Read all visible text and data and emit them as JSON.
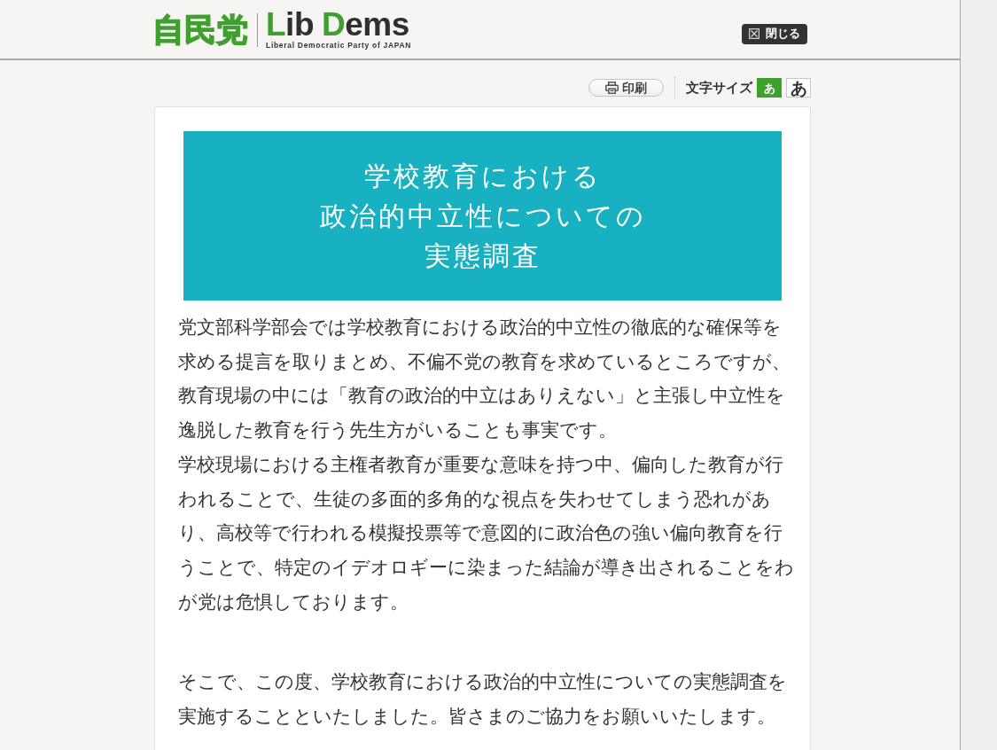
{
  "header": {
    "logo": {
      "mark": "自民党",
      "wordmark": [
        [
          {
            "text": "L",
            "accent": true
          },
          {
            "text": "ib",
            "accent": false
          }
        ],
        [
          {
            "text": "D",
            "accent": true
          },
          {
            "text": "ems",
            "accent": false
          }
        ]
      ],
      "tagline": "Liberal Democratic Party of JAPAN"
    },
    "close_button": {
      "label": "閉じる"
    }
  },
  "toolbar": {
    "print_button": {
      "label": "印刷"
    },
    "text_size": {
      "label": "文字サイズ",
      "options": [
        {
          "label": "あ",
          "kind": "small",
          "selected": true
        },
        {
          "label": "あ",
          "kind": "large",
          "selected": false
        }
      ]
    }
  },
  "article": {
    "banner": {
      "title_lines": [
        "学校教育における",
        "政治的中立性についての",
        "実態調査"
      ]
    },
    "blocks": [
      {
        "paragraphs": [
          {
            "lines": [
              "党文部科学部会では学校教育における政治的中立性の徹底的な確保等を",
              "求める提言を取りまとめ、不偏不党の教育を求めているところですが、",
              "教育現場の中には「教育の政治的中立はありえない」と主張し中立性を",
              "逸脱した教育を行う先生方がいることも事実です。"
            ]
          },
          {
            "lines": [
              "学校現場における主権者教育が重要な意味を持つ中、偏向した教育が行",
              "われることで、生徒の多面的多角的な視点を失わせてしまう恐れがあ",
              "り、高校等で行われる模擬投票等で意図的に政治色の強い偏向教育を行",
              "うことで、特定のイデオロギーに染まった結論が導き出されることをわ",
              "が党は危惧しております。"
            ]
          }
        ]
      },
      {
        "paragraphs": [
          {
            "lines": [
              "そこで、この度、学校教育における政治的中立性についての実態調査を",
              "実施することといたしました。皆さまのご協力をお願いいたします。"
            ]
          }
        ]
      }
    ]
  }
}
